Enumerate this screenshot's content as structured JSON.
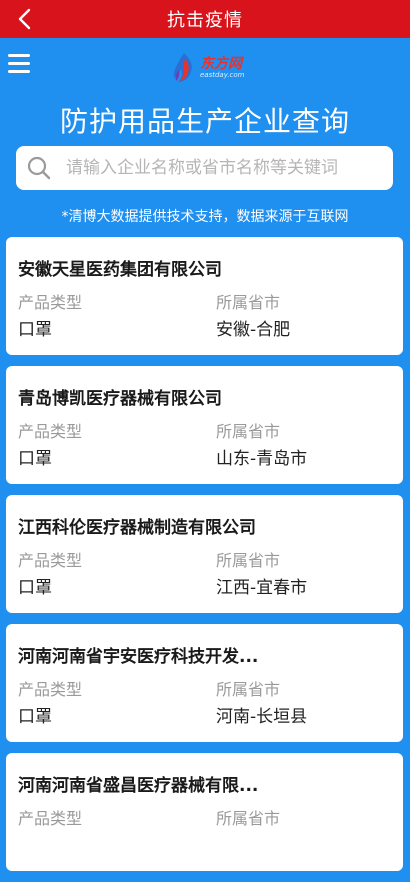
{
  "topbar": {
    "title": "抗击疫情",
    "back_icon": "chevron-left-icon"
  },
  "hero": {
    "menu_icon": "hamburger-menu-icon",
    "logo": {
      "cn": "东方网",
      "en": "eastday.com"
    },
    "title": "防护用品生产企业查询",
    "search": {
      "placeholder": "请输入企业名称或省市名称等关键词",
      "value": "",
      "icon": "search-icon"
    },
    "source_note": "*清博大数据提供技术支持，数据来源于互联网"
  },
  "labels": {
    "product_type": "产品类型",
    "province_city": "所属省市"
  },
  "companies": [
    {
      "name": "安徽天星医药集团有限公司",
      "product_type": "口罩",
      "location": "安徽-合肥"
    },
    {
      "name": "青岛博凯医疗器械有限公司",
      "product_type": "口罩",
      "location": "山东-青岛市"
    },
    {
      "name": "江西科伦医疗器械制造有限公司",
      "product_type": "口罩",
      "location": "江西-宜春市"
    },
    {
      "name": "河南河南省宇安医疗科技开发...",
      "product_type": "口罩",
      "location": "河南-长垣县"
    },
    {
      "name": "河南河南省盛昌医疗器械有限...",
      "product_type": "",
      "location": ""
    }
  ],
  "colors": {
    "topbar": "#d9131b",
    "background": "#1f8ff0",
    "card": "#ffffff",
    "label": "#9a9a9a"
  }
}
